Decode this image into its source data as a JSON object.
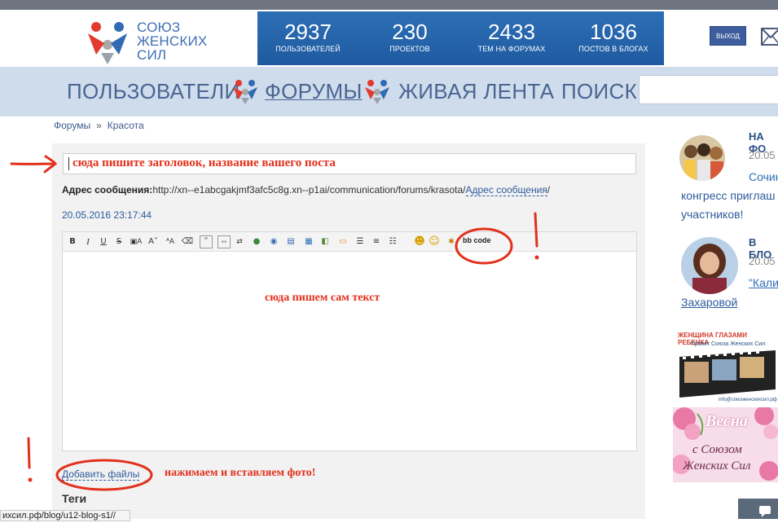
{
  "logo": {
    "line1": "СОЮЗ",
    "line2": "ЖЕНСКИХ",
    "line3": "СИЛ"
  },
  "stats": [
    {
      "value": "2937",
      "label": "ПОЛЬЗОВАТЕЛЕЙ"
    },
    {
      "value": "230",
      "label": "ПРОЕКТОВ"
    },
    {
      "value": "2433",
      "label": "ТЕМ НА ФОРУМАХ"
    },
    {
      "value": "1036",
      "label": "ПОСТОВ В БЛОГАХ"
    }
  ],
  "header": {
    "logout_label": "ВЫХОД"
  },
  "nav": {
    "users": "ПОЛЬЗОВАТЕЛИ",
    "forums": "ФОРУМЫ",
    "feed": "ЖИВАЯ ЛЕНТА",
    "search": "ПОИСК"
  },
  "breadcrumb": {
    "root": "Форумы",
    "sep": "»",
    "current": "Красота"
  },
  "form": {
    "title_annotation": "сюда пишите заголовок, название вашего поста",
    "address_label": "Адрес сообщения:",
    "address_url": "http://xn--e1abcgakjmf3afc5c8g.xn--p1ai/communication/forums/krasota/",
    "address_link": "Адрес сообщения",
    "date": "20.05.2016 23:17:44",
    "bbcode_label": "bb code",
    "editor_annotation": "сюда пишем сам текст",
    "add_files": "Добавить файлы",
    "add_files_annotation": "нажимаем и вставляем фото!",
    "tags_label": "Теги"
  },
  "statusbar": {
    "url": "ихсил.рф/blog/u12-blog-s1//"
  },
  "sidebar": {
    "block1": {
      "head": "НА ФО",
      "date": "20.05",
      "text1": "Сочин",
      "text2": "конгресс приглаш",
      "text3": "участников!"
    },
    "block2": {
      "head": "В БЛО",
      "date": "20.05",
      "text1": "\"Кали",
      "text2": "Захаровой"
    },
    "banner1": {
      "title": "ЖЕНЩИНА ГЛАЗАМИ РЕБЕНКА",
      "sub": "Проект Союза Женских Сил",
      "email": "info@союзженскихсил.рф"
    },
    "banner2": {
      "line1": "Весна",
      "line2": "с Союзом",
      "line3": "Женских Сил"
    }
  },
  "colors": {
    "stats_bg": "#2d6fb6",
    "nav_bg": "#cfdcec",
    "annotation": "#e3301c",
    "link": "#2d5a9c"
  }
}
